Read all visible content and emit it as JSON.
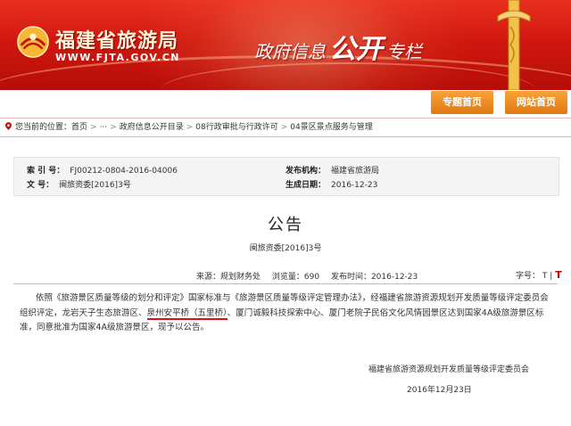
{
  "header": {
    "site_name": "福建省旅游局",
    "site_url": "WWW.FJTA.GOV.CN",
    "slogan_part1": "政府信息",
    "slogan_part2": "公开",
    "slogan_part3": "专栏"
  },
  "nav": {
    "topic_home": "专题首页",
    "site_home": "网站首页"
  },
  "breadcrumb": {
    "prefix": "您当前的位置：首页",
    "items": [
      "···",
      "政府信息公开目录",
      "08行政审批与行政许可",
      "04景区景点服务与管理"
    ]
  },
  "meta": {
    "index_label": "索 引 号：",
    "index_value": "FJ00212-0804-2016-04006",
    "doc_label": "文    号：",
    "doc_value": "闽旅资委[2016]3号",
    "publisher_label": "发布机构：",
    "publisher_value": "福建省旅游局",
    "date_label": "生成日期：",
    "date_value": "2016-12-23"
  },
  "article": {
    "title": "公告",
    "doc_number": "闽旅资委[2016]3号",
    "source": "来源：规划财务处",
    "views": "浏览量：690",
    "publish_date": "发布时间：2016-12-23",
    "font_size_label": "字号：",
    "font_small": "T",
    "font_separator": "|",
    "font_large": "T",
    "body_before": "依照《旅游景区质量等级的划分和评定》国家标准与《旅游景区质量等级评定管理办法》，经福建省旅游资源规划开发质量等级评定委员会组织评定，龙岩天子生态旅游区、",
    "body_highlight": "泉州安平桥（五里桥）",
    "body_after": "、厦门诚毅科技探索中心、厦门老院子民俗文化风情园景区达到国家4A级旅游景区标准，同意批准为国家4A级旅游景区，现予以公告。",
    "org": "福建省旅游资源规划开发质量等级评定委员会",
    "sign_date": "2016年12月23日"
  },
  "colors": {
    "banner_red": "#d0180f",
    "nav_orange": "#e07a12",
    "highlight_underline": "#d11111"
  }
}
